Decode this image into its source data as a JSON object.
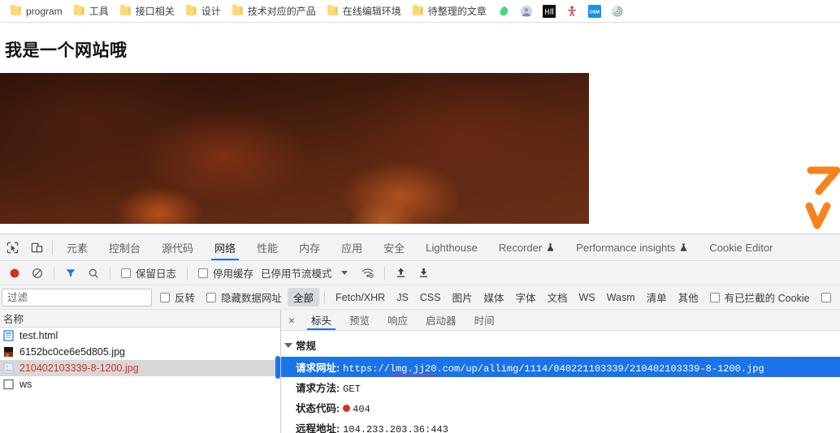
{
  "bookmarks": {
    "folders": [
      {
        "label": "program",
        "icon": "folder-icon"
      },
      {
        "label": "工具",
        "icon": "folder-icon"
      },
      {
        "label": "接口相关",
        "icon": "folder-icon"
      },
      {
        "label": "设计",
        "icon": "folder-icon"
      },
      {
        "label": "技术对应的产品",
        "icon": "folder-icon"
      },
      {
        "label": "在线编辑环境",
        "icon": "folder-icon"
      },
      {
        "label": "待整理的文章",
        "icon": "folder-icon"
      }
    ],
    "icon_shortcuts": [
      {
        "name": "green-leaf-icon"
      },
      {
        "name": "avatar-circle-icon"
      },
      {
        "name": "medium-m-icon",
        "glyph": "M"
      },
      {
        "name": "red-figure-icon"
      },
      {
        "name": "dsm-icon",
        "glyph": "DSM"
      },
      {
        "name": "spiral-icon"
      }
    ]
  },
  "page": {
    "title": "我是一个网站哦",
    "hero_alt": "dark-red-smoke-image",
    "annotation": "orange-handwritten-mark"
  },
  "devtools": {
    "main_tabs": [
      {
        "label": "元素",
        "active": false
      },
      {
        "label": "控制台",
        "active": false
      },
      {
        "label": "源代码",
        "active": false
      },
      {
        "label": "网络",
        "active": true
      },
      {
        "label": "性能",
        "active": false
      },
      {
        "label": "内存",
        "active": false
      },
      {
        "label": "应用",
        "active": false
      },
      {
        "label": "安全",
        "active": false
      },
      {
        "label": "Lighthouse",
        "active": false
      },
      {
        "label": "Recorder",
        "active": false,
        "badge": "experiment-flask-icon"
      },
      {
        "label": "Performance insights",
        "active": false,
        "badge": "experiment-flask-icon"
      },
      {
        "label": "Cookie Editor",
        "active": false
      }
    ],
    "toolbar": {
      "record_icon": "record-button-icon",
      "clear_icon": "clear-icon",
      "filter_icon": "filter-icon",
      "search_icon": "search-icon",
      "preserve_log_label": "保留日志",
      "preserve_log_checked": false,
      "disable_cache_label": "停用缓存",
      "disable_cache_checked": false,
      "throttle_label": "已停用节流模式",
      "wifi_icon": "network-conditions-icon",
      "import_icon": "import-har-icon",
      "export_icon": "export-har-icon"
    },
    "filterbar": {
      "filter_placeholder": "过滤",
      "filter_value": "",
      "invert_label": "反转",
      "invert_checked": false,
      "hide_data_urls_label": "隐藏数据网址",
      "hide_data_urls_checked": false,
      "types": [
        "全部",
        "Fetch/XHR",
        "JS",
        "CSS",
        "图片",
        "媒体",
        "字体",
        "文档",
        "WS",
        "Wasm",
        "清单",
        "其他"
      ],
      "selected_type": "全部",
      "blocked_cookies_label": "有已拦截的 Cookie",
      "blocked_cookies_checked": false
    },
    "requests": {
      "column_header": "名称",
      "rows": [
        {
          "name": "test.html",
          "icon": "document-file-icon",
          "selected": false,
          "error": false
        },
        {
          "name": "6152bc0ce6e5d805.jpg",
          "icon": "image-thumbnail-icon",
          "selected": false,
          "error": false
        },
        {
          "name": "210402103339-8-1200.jpg",
          "icon": "image-placeholder-icon",
          "selected": true,
          "error": true
        },
        {
          "name": "ws",
          "icon": "websocket-icon",
          "selected": false,
          "error": false
        }
      ]
    },
    "detail": {
      "close_label": "×",
      "tabs": [
        {
          "label": "标头",
          "active": true
        },
        {
          "label": "预览",
          "active": false
        },
        {
          "label": "响应",
          "active": false
        },
        {
          "label": "启动器",
          "active": false
        },
        {
          "label": "时间",
          "active": false
        }
      ],
      "section_title": "常规",
      "fields": [
        {
          "key": "请求网址:",
          "value": "https://lmg.jj20.com/up/allimg/1114/040221103339/210402103339-8-1200.jpg",
          "highlight": true,
          "marked": true
        },
        {
          "key": "请求方法:",
          "value": "GET",
          "highlight": false
        },
        {
          "key": "状态代码:",
          "value": "404",
          "highlight": false,
          "status_dot": true
        },
        {
          "key": "远程地址:",
          "value": "104.233.203.36:443",
          "highlight": false
        }
      ]
    }
  },
  "colors": {
    "accent": "#1a73e8",
    "error": "#d93025",
    "marker": "#f0299e",
    "annotation": "#f7831f",
    "folder": "#fcd975"
  }
}
